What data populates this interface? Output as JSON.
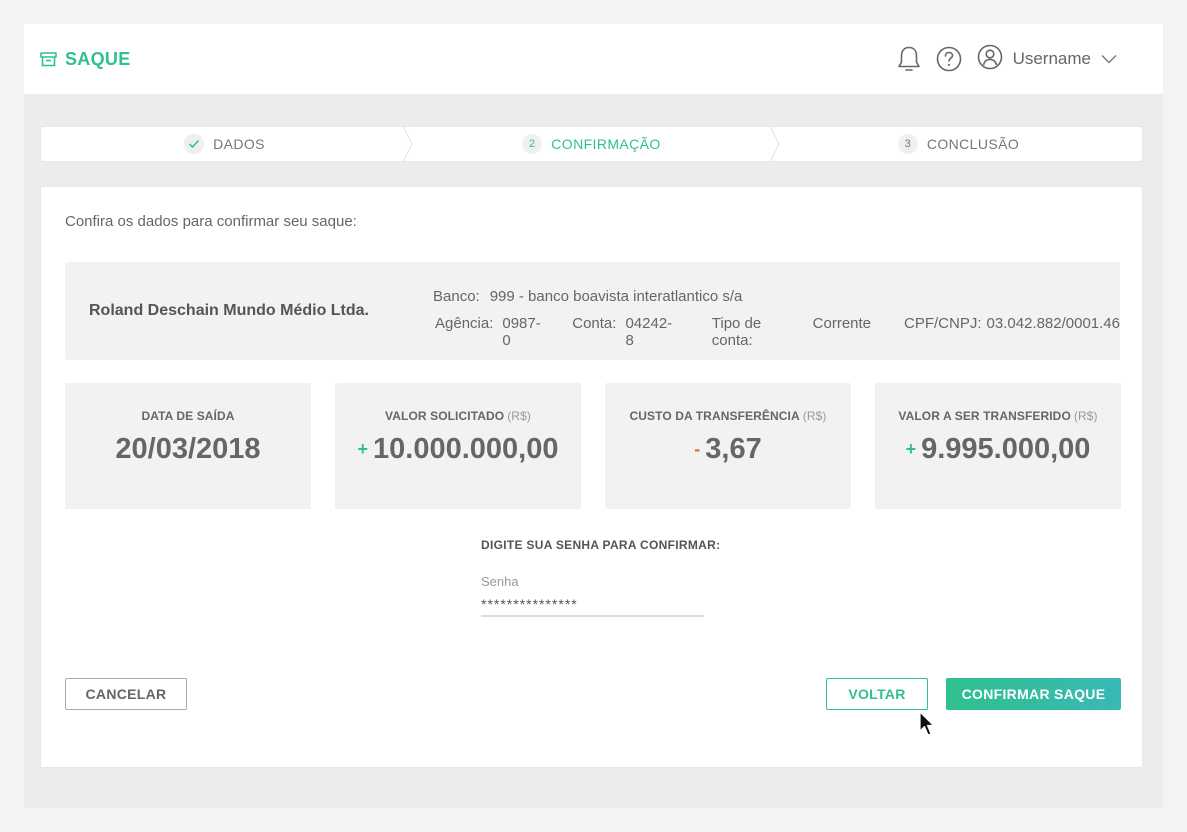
{
  "header": {
    "title": "SAQUE",
    "username": "Username"
  },
  "steps": [
    {
      "label": "DADOS",
      "state": "done"
    },
    {
      "label": "CONFIRMAÇÃO",
      "number": "2",
      "state": "active"
    },
    {
      "label": "CONCLUSÃO",
      "number": "3",
      "state": "pending"
    }
  ],
  "main": {
    "intro": "Confira os dados para confirmar seu saque:",
    "bank": {
      "company": "Roland Deschain Mundo Médio Ltda.",
      "banco_label": "Banco:",
      "banco_value": "999 - banco boavista interatlantico s/a",
      "agencia_label": "Agência:",
      "agencia_value": "0987-0",
      "conta_label": "Conta:",
      "conta_value": "04242-8",
      "tipo_label": "Tipo de conta:",
      "tipo_value": "Corrente",
      "cpf_label": "CPF/CNPJ:",
      "cpf_value": "03.042.882/0001.46"
    },
    "tiles": [
      {
        "label": "DATA DE SAÍDA",
        "currency": "",
        "sign": "",
        "value": "20/03/2018"
      },
      {
        "label": "VALOR SOLICITADO",
        "currency": "(R$)",
        "sign": "+",
        "value": "10.000.000,00"
      },
      {
        "label": "CUSTO DA TRANSFERÊNCIA",
        "currency": "(R$)",
        "sign": "-",
        "value": "3,67"
      },
      {
        "label": "VALOR A SER TRANSFERIDO",
        "currency": "(R$)",
        "sign": "+",
        "value": "9.995.000,00"
      }
    ],
    "password": {
      "title": "DIGITE SUA SENHA PARA CONFIRMAR:",
      "label": "Senha",
      "value": "***************"
    },
    "buttons": {
      "cancel": "CANCELAR",
      "back": "VOLTAR",
      "confirm": "CONFIRMAR SAQUE"
    }
  },
  "colors": {
    "accent": "#2fc08f",
    "accent_end": "#3ab8b5",
    "negative": "#e8684a"
  },
  "icons": [
    "archive-icon",
    "bell-icon",
    "help-icon",
    "user-icon",
    "chevron-down-icon",
    "check-icon"
  ]
}
